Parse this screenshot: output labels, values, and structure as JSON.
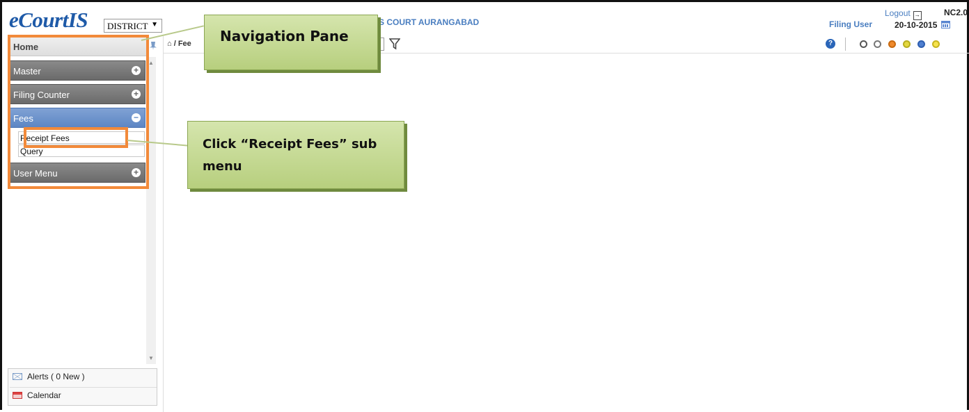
{
  "header": {
    "logo": "eCourtIS",
    "district_select": "DISTRICT",
    "court_name": "S COURT AURANGABAD",
    "user": "Filing User",
    "logout": "Logout",
    "version": "NC2.0",
    "date": "20-10-2015"
  },
  "toolbar": {
    "breadcrumb": "/ Fee",
    "status_dots": [
      {
        "fill": "#ffffff",
        "border": "#555555"
      },
      {
        "fill": "#ffffff",
        "border": "#777777"
      },
      {
        "fill": "#f08a2c",
        "border": "#c86a10"
      },
      {
        "fill": "#e4d840",
        "border": "#b8ae20"
      },
      {
        "fill": "#4f7fd0",
        "border": "#2f5fb0"
      },
      {
        "fill": "#f6e34e",
        "border": "#c8b520"
      }
    ]
  },
  "sidebar": {
    "home": "Home",
    "items": [
      {
        "label": "Master",
        "toggle": "+"
      },
      {
        "label": "Filing Counter",
        "toggle": "+"
      },
      {
        "label": "Fees",
        "toggle": "−"
      },
      {
        "label": "User Menu",
        "toggle": "+"
      }
    ],
    "fees_submenu": [
      "Receipt Fees",
      "Query"
    ],
    "bottom_links": [
      "Alerts ( 0 New )",
      "Calendar"
    ]
  },
  "annotations": {
    "nav_pane": "Navigation Pane",
    "receipt_fees_hint_line1": "Click “Receipt Fees” sub",
    "receipt_fees_hint_line2": "menu"
  },
  "colors": {
    "accent_blue": "#4a7ec0",
    "highlight_orange": "#f28a3a",
    "callout_green": "#c5da95"
  }
}
